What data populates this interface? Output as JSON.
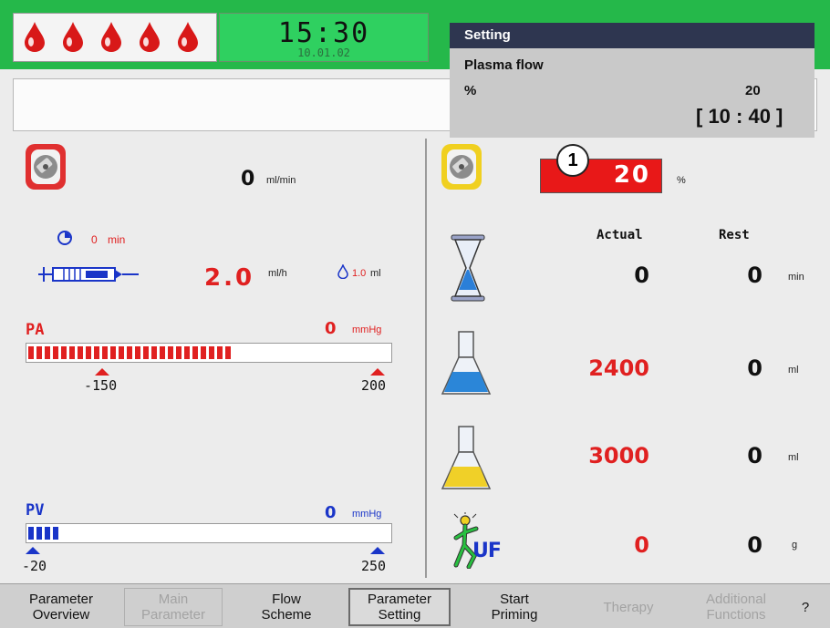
{
  "header": {
    "time": "15:30",
    "date": "10.01.02"
  },
  "setting": {
    "title": "Setting",
    "parameter": "Plasma flow",
    "unit": "%",
    "value": "20",
    "range": "[ 10 : 40 ]"
  },
  "left": {
    "blood_pump": {
      "value": "0",
      "unit": "ml/min"
    },
    "timer": {
      "value": "0",
      "unit": "min"
    },
    "syringe": {
      "rate": "2.0",
      "rate_unit": "ml/h",
      "volume": "1.0",
      "volume_unit": "ml"
    },
    "pa": {
      "label": "PA",
      "value": "0",
      "unit": "mmHg",
      "min_label": "-150",
      "max_label": "200",
      "fill_fraction": 0.57
    },
    "pv": {
      "label": "PV",
      "value": "0",
      "unit": "mmHg",
      "min_label": "-20",
      "max_label": "250",
      "fill_fraction": 0.095
    }
  },
  "right": {
    "plasma_pump": {
      "callout": "1",
      "value": "20",
      "unit": "%"
    },
    "col_actual": "Actual",
    "col_rest": "Rest",
    "rows": [
      {
        "icon": "hourglass-icon",
        "actual": "0",
        "rest": "0",
        "unit": "min"
      },
      {
        "icon": "blue-flask-icon",
        "actual": "2400",
        "rest": "0",
        "unit": "ml"
      },
      {
        "icon": "yellow-flask-icon",
        "actual": "3000",
        "rest": "0",
        "unit": "ml"
      },
      {
        "icon": "uf-icon",
        "actual": "0",
        "rest": "0",
        "unit": "g",
        "icon_text": "UF"
      }
    ]
  },
  "nav": [
    {
      "label": "Parameter\nOverview",
      "state": "normal"
    },
    {
      "label": "Main\nParameter",
      "state": "disabled"
    },
    {
      "label": "Flow\nScheme",
      "state": "normal"
    },
    {
      "label": "Parameter\nSetting",
      "state": "active"
    },
    {
      "label": "Start\nPriming",
      "state": "normal"
    },
    {
      "label": "Therapy",
      "state": "disabled"
    },
    {
      "label": "Additional\nFunctions",
      "state": "disabled"
    },
    {
      "label": "?",
      "state": "normal"
    }
  ],
  "colors": {
    "green": "#25b84a",
    "red": "#e02020",
    "blue": "#1a35c8"
  }
}
